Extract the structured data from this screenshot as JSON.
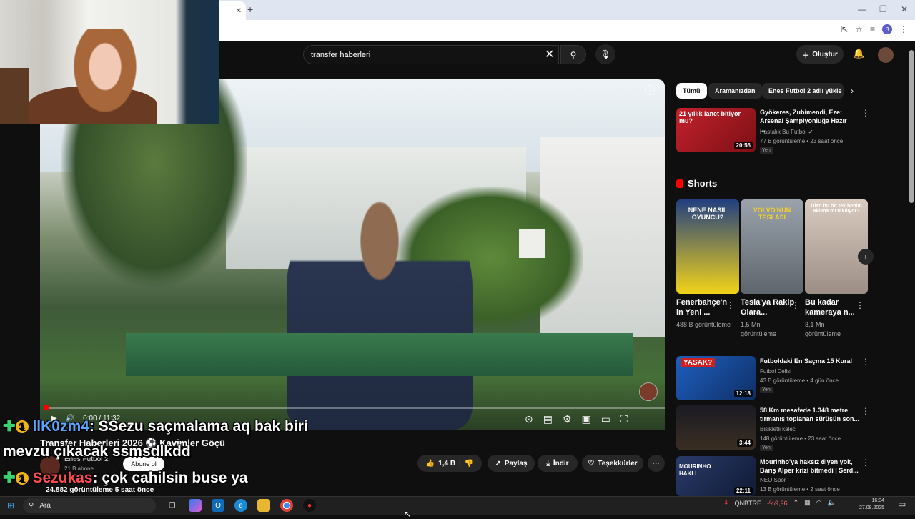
{
  "browser": {
    "tab_close": "✕",
    "new_tab": "+",
    "avatar_letter": "B"
  },
  "header": {
    "search_value": "transfer haberleri",
    "create_label": "Oluştur"
  },
  "player": {
    "time": "0:00 / 11:32",
    "progress": 0.0
  },
  "video": {
    "title": "Transfer Haberleri 2026 ⚽ Kavimler Göçü",
    "channel": "Enes Futbol 2",
    "subscribers": "21 B abone",
    "subscribe_label": "Abone ol",
    "likes": "1,4 B",
    "share_label": "Paylaş",
    "download_label": "İndir",
    "thanks_label": "Teşekkürler",
    "views_line": "24.882 görüntüleme  5 saat önce"
  },
  "chat": [
    {
      "user": "llK0zm4",
      "message": ": SSezu saçmalama aq bak biri"
    },
    {
      "user": "",
      "message": "mevzu çıkacak ssmsdlkdd"
    },
    {
      "user": "Sezukas",
      "message": ": çok cahilsin buse ya"
    }
  ],
  "sidebar": {
    "chips": [
      "Tümü",
      "Aramanızdan",
      "Enes Futbol 2 adlı yükle"
    ],
    "videos": [
      {
        "title": "Gyökeres, Zubimendi, Eze: Arsenal Şampiyonluğa Hazır ...",
        "channel": "Hastalık Bu Futbol",
        "meta": "77 B görüntüleme • 23 saat önce",
        "badge": "Yeni",
        "duration": "20:56",
        "thumb_text": "21 yıllık lanet bitiyor mu?",
        "color": "#b3202a"
      },
      {
        "title": "Futboldaki En Saçma 15 Kural",
        "channel": "Futbol Delisi",
        "meta": "43 B görüntüleme • 4 gün önce",
        "badge": "Yeni",
        "duration": "12:18",
        "thumb_text": "YASAK?",
        "color": "#1e5fbf"
      },
      {
        "title": "58 Km mesafede 1.348 metre tırmanış toplanan sürüşün son...",
        "channel": "Bisikletli kaleci",
        "meta": "148 görüntüleme • 23 saat önce",
        "badge": "Yeni",
        "duration": "3:44",
        "thumb_text": "",
        "color": "#2b2b33"
      },
      {
        "title": "Mourinho'ya haksız diyen yok, Barış Alper krizi bitmedi | Serd...",
        "channel": "NEO Spor",
        "meta": "13 B görüntüleme • 2 saat önce",
        "badge": "",
        "duration": "22:11",
        "thumb_text": "MOURINHO HAKLI",
        "color": "#2a3b6b"
      }
    ],
    "shorts_title": "Shorts",
    "shorts": [
      {
        "title": "Fenerbahçe'n in Yeni ...",
        "meta": "488 B görüntüleme",
        "thumb_text": "NENE NASIL OYUNCU?",
        "color": "#2a56a8"
      },
      {
        "title": "Tesla'ya Rakip Olara...",
        "meta": "1,5 Mn görüntüleme",
        "thumb_text": "VOLVO'NUN TESLASI",
        "color": "#8a8f96"
      },
      {
        "title": "Bu kadar kameraya n...",
        "meta": "3,1 Mn görüntüleme",
        "thumb_text": "Ulan bu bir tek benim aklıma mı takılıyor?",
        "color": "#c9b9ae"
      }
    ]
  },
  "taskbar": {
    "search_placeholder": "Ara",
    "ticker_name": "QNBTRE",
    "ticker_change": "-%9,96",
    "time": "16:34",
    "date": "27.08.2025"
  },
  "colors": {
    "accent_red": "#ff0000",
    "bg": "#0f0f0f",
    "chip_bg": "#272727"
  }
}
